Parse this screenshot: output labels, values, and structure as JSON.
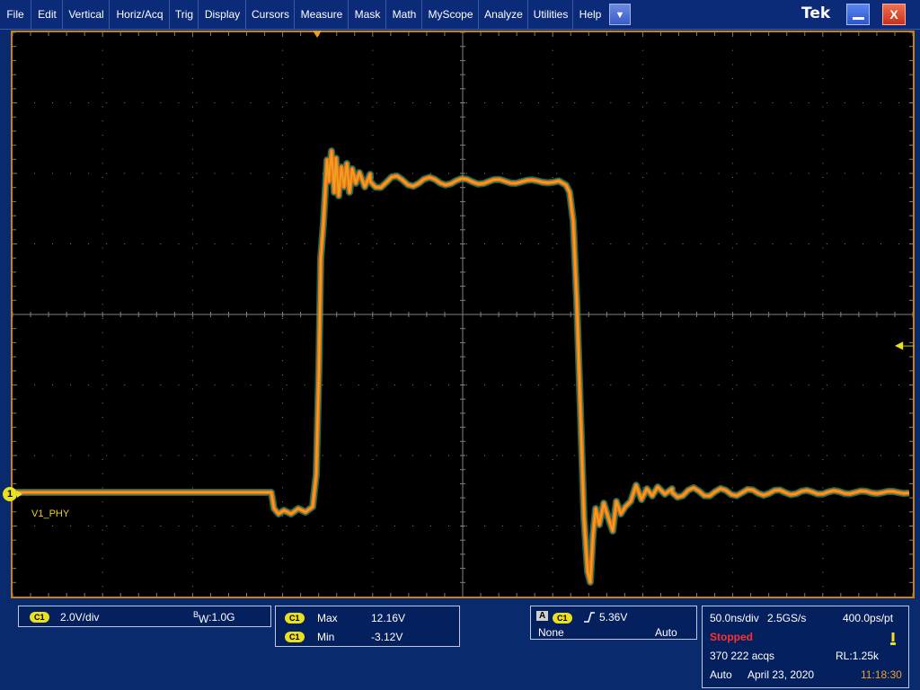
{
  "menu": {
    "items": [
      "File",
      "Edit",
      "Vertical",
      "Horiz/Acq",
      "Trig",
      "Display",
      "Cursors",
      "Measure",
      "Mask",
      "Math",
      "MyScope",
      "Analyze",
      "Utilities",
      "Help"
    ]
  },
  "brand": {
    "logo": "Tek"
  },
  "channel": {
    "id": "1",
    "label": "V1_PHY",
    "badge": "C1",
    "scale": "2.0V/div",
    "bandwidth_prefix": "B",
    "bandwidth_sub": "W",
    "bandwidth_value": ":1.0G"
  },
  "measurements": {
    "badge": "C1",
    "rows": [
      {
        "name": "Max",
        "value": "12.16V"
      },
      {
        "name": "Min",
        "value": "-3.12V"
      }
    ]
  },
  "trigger": {
    "mode_letter": "A",
    "badge": "C1",
    "level": "5.36V",
    "none_label": "None",
    "auto_label": "Auto"
  },
  "acquisition": {
    "timebase": "50.0ns/div",
    "sample_rate": "2.5GS/s",
    "resolution": "400.0ps/pt",
    "state": "Stopped",
    "acqs": "370 222 acqs",
    "record_length": "RL:1.25k",
    "trigger_mode": "Auto",
    "date": "April 23, 2020",
    "time": "11:18:30"
  },
  "colors": {
    "trace": "#e87018",
    "trace_core": "#f0a020",
    "trace_glow": "#20c0a0",
    "grid": "#808080",
    "channel": "#e8e020",
    "border": "#c8801a",
    "stopped": "#ff3030",
    "time": "#f0a020"
  }
}
